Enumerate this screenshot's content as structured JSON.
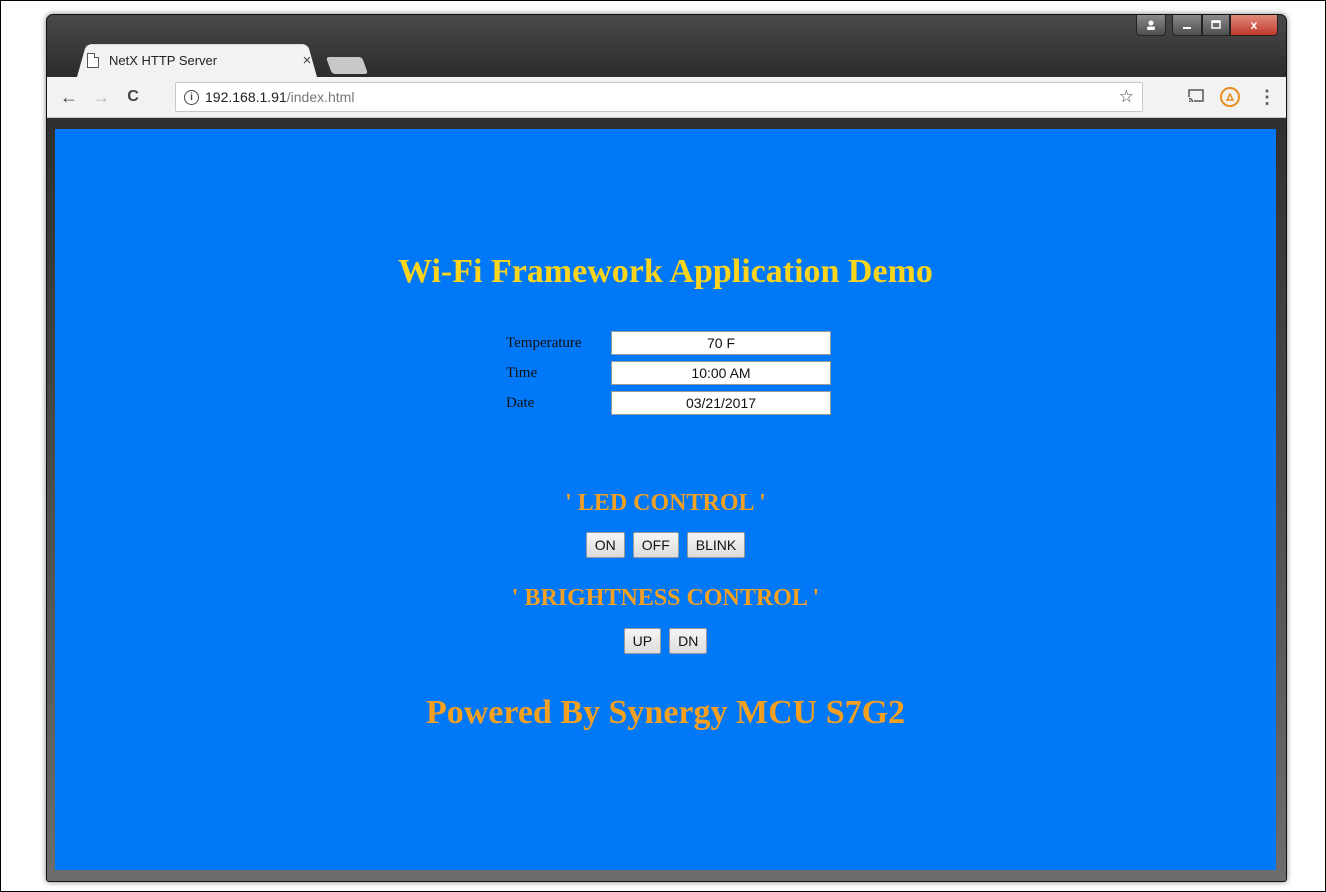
{
  "browser": {
    "tab_title": "NetX HTTP Server",
    "tab_close": "×",
    "url_host": "192.168.1.91",
    "url_path": "/index.html",
    "back_glyph": "←",
    "forward_glyph": "→",
    "reload_glyph": "C",
    "info_glyph": "i",
    "star_glyph": "☆",
    "menu_glyph": "⋮",
    "close_glyph": "x",
    "icons": [
      "page-icon",
      "back-icon",
      "forward-icon",
      "reload-icon",
      "info-icon",
      "star-icon",
      "cast-icon",
      "extension-icon",
      "menu-icon"
    ]
  },
  "page": {
    "title": "Wi-Fi Framework Application Demo",
    "sensors": [
      {
        "label": "Temperature",
        "value": "70 F"
      },
      {
        "label": "Time",
        "value": "10:00 AM"
      },
      {
        "label": "Date",
        "value": "03/21/2017"
      }
    ],
    "led_control": {
      "title": "' LED CONTROL '",
      "buttons": [
        "ON",
        "OFF",
        "BLINK"
      ]
    },
    "brightness_control": {
      "title": "' BRIGHTNESS CONTROL '",
      "buttons": [
        "UP",
        "DN"
      ]
    },
    "footer": "Powered By Synergy MCU S7G2"
  },
  "colors": {
    "page_background": "#0078f8",
    "title_yellow": "#fbd41e",
    "accent_orange": "#f5a020"
  }
}
